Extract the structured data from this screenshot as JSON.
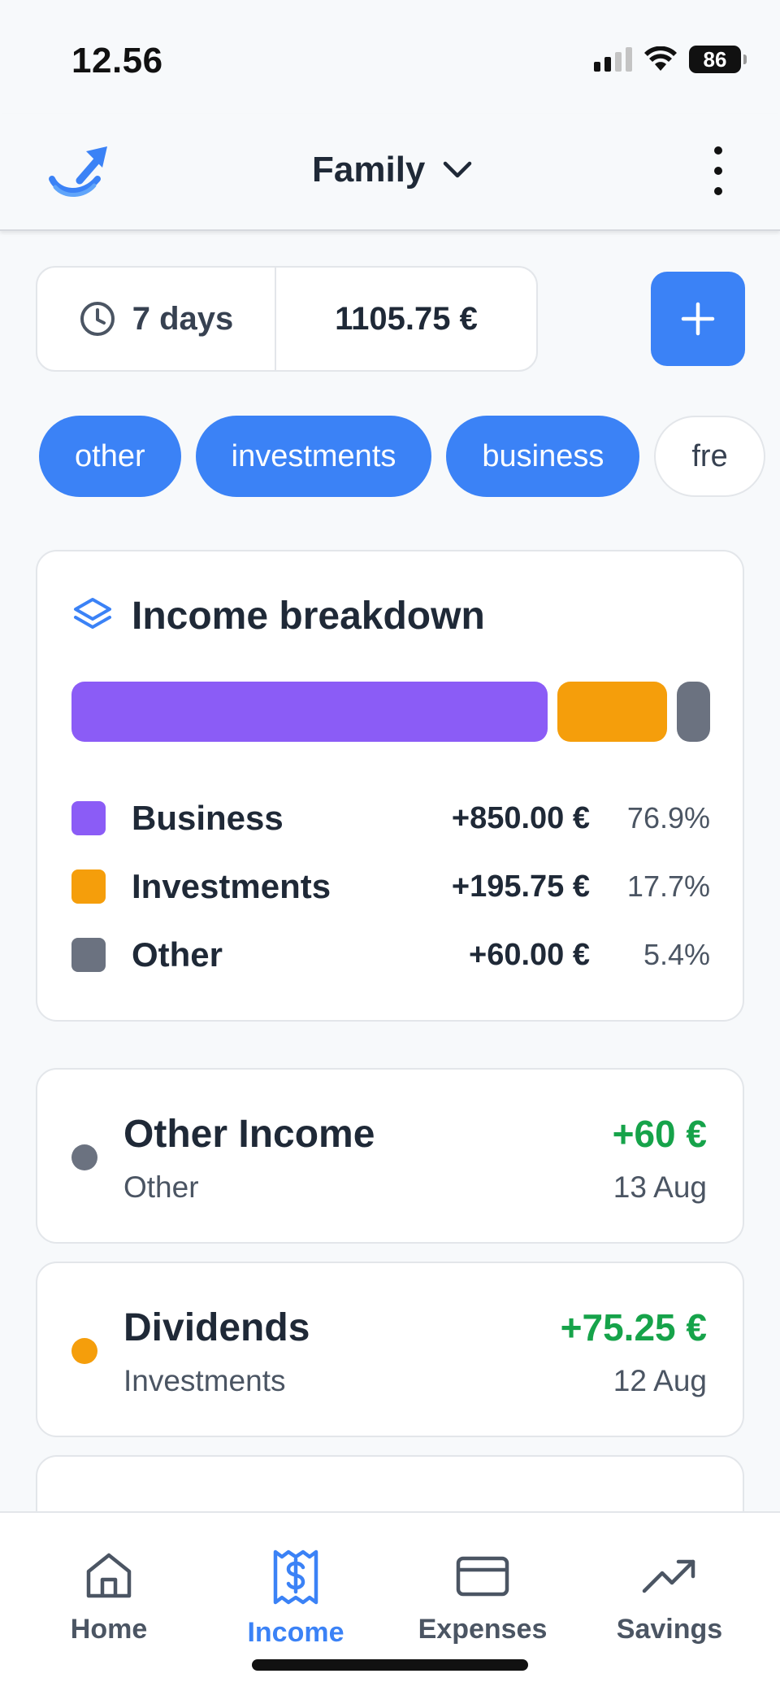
{
  "status_bar": {
    "time": "12.56",
    "battery": "86"
  },
  "header": {
    "group_label": "Family"
  },
  "summary": {
    "period": "7 days",
    "total": "1105.75 €"
  },
  "filters": [
    {
      "label": "other",
      "active": true
    },
    {
      "label": "investments",
      "active": true
    },
    {
      "label": "business",
      "active": true
    },
    {
      "label": "fre",
      "active": false
    }
  ],
  "breakdown": {
    "title": "Income breakdown",
    "items": [
      {
        "name": "Business",
        "amount": "+850.00 €",
        "percent": "76.9%",
        "share": 0.769,
        "color": "#8b5cf6"
      },
      {
        "name": "Investments",
        "amount": "+195.75 €",
        "percent": "17.7%",
        "share": 0.177,
        "color": "#f59e0b"
      },
      {
        "name": "Other",
        "amount": "+60.00 €",
        "percent": "5.4%",
        "share": 0.054,
        "color": "#6b7280"
      }
    ]
  },
  "transactions": [
    {
      "title": "Other Income",
      "category": "Other",
      "amount": "+60 €",
      "date": "13 Aug",
      "color": "#6b7280"
    },
    {
      "title": "Dividends",
      "category": "Investments",
      "amount": "+75.25 €",
      "date": "12 Aug",
      "color": "#f59e0b"
    }
  ],
  "nav": [
    {
      "label": "Home",
      "icon": "home-icon",
      "active": false
    },
    {
      "label": "Income",
      "icon": "receipt-dollar-icon",
      "active": true
    },
    {
      "label": "Expenses",
      "icon": "credit-card-icon",
      "active": false
    },
    {
      "label": "Savings",
      "icon": "trending-up-icon",
      "active": false
    }
  ],
  "colors": {
    "accent": "#3b82f6",
    "positive": "#16a34a"
  }
}
